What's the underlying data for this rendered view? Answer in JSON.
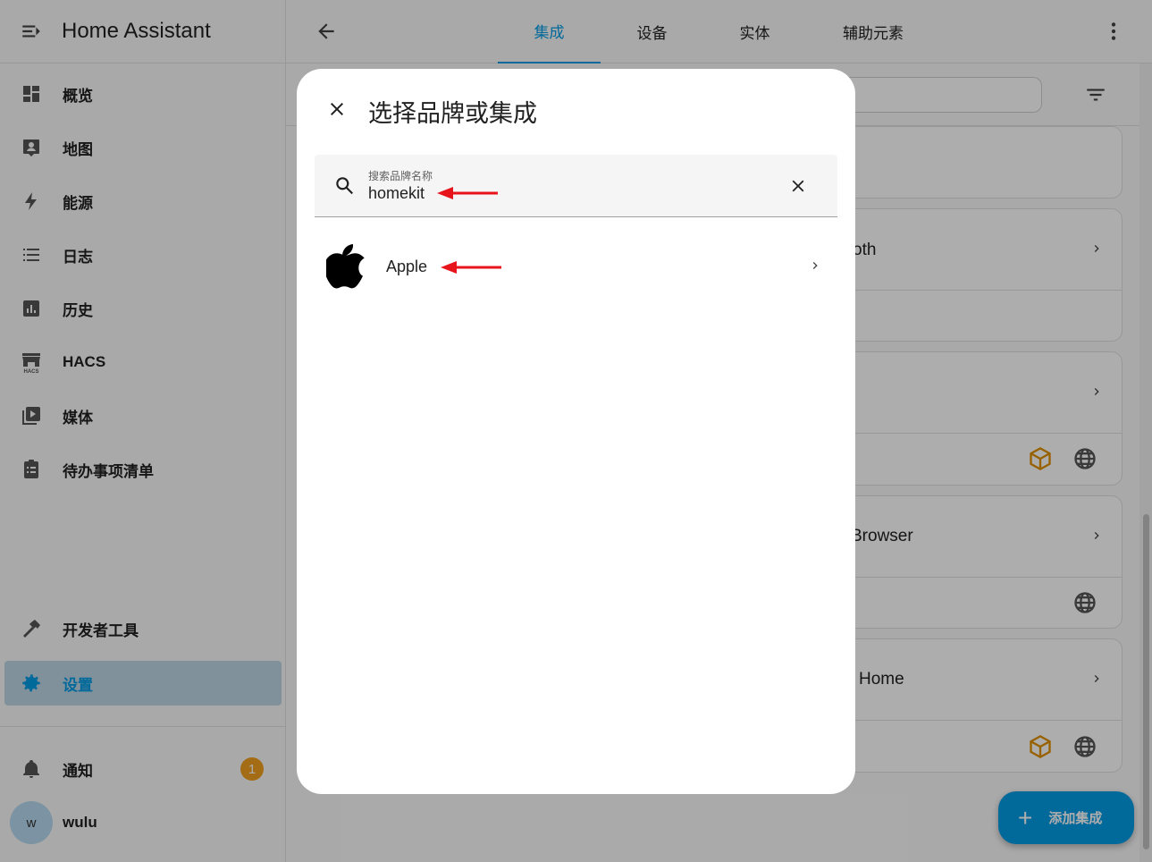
{
  "sidebar": {
    "title": "Home Assistant",
    "items": [
      {
        "label": "概览",
        "icon": "dashboard-icon"
      },
      {
        "label": "地图",
        "icon": "map-account-icon"
      },
      {
        "label": "能源",
        "icon": "lightning-icon"
      },
      {
        "label": "日志",
        "icon": "list-icon"
      },
      {
        "label": "历史",
        "icon": "chart-box-icon"
      },
      {
        "label": "HACS",
        "icon": "hacs-store-icon"
      },
      {
        "label": "媒体",
        "icon": "media-play-icon"
      },
      {
        "label": "待办事项清单",
        "icon": "clipboard-list-icon"
      }
    ],
    "dev_tools": "开发者工具",
    "settings": "设置",
    "notifications": {
      "label": "通知",
      "count": "1"
    },
    "user": {
      "initial": "w",
      "name": "wulu"
    }
  },
  "topbar": {
    "tabs": [
      "集成",
      "设备",
      "实体",
      "辅助元素"
    ],
    "active_tab": "集成"
  },
  "background_cards": {
    "titles": [
      "oth",
      "Browser",
      "Home"
    ]
  },
  "fab": {
    "label": "添加集成"
  },
  "dialog": {
    "title": "选择品牌或集成",
    "search": {
      "label": "搜索品牌名称",
      "value": "homekit"
    },
    "results": [
      {
        "name": "Apple",
        "icon": "apple-logo-icon"
      }
    ]
  },
  "colors": {
    "accent": "#039be5",
    "annotation_arrow": "#e8141b",
    "badge": "#f0a020",
    "hacs_orange": "#e09000"
  }
}
